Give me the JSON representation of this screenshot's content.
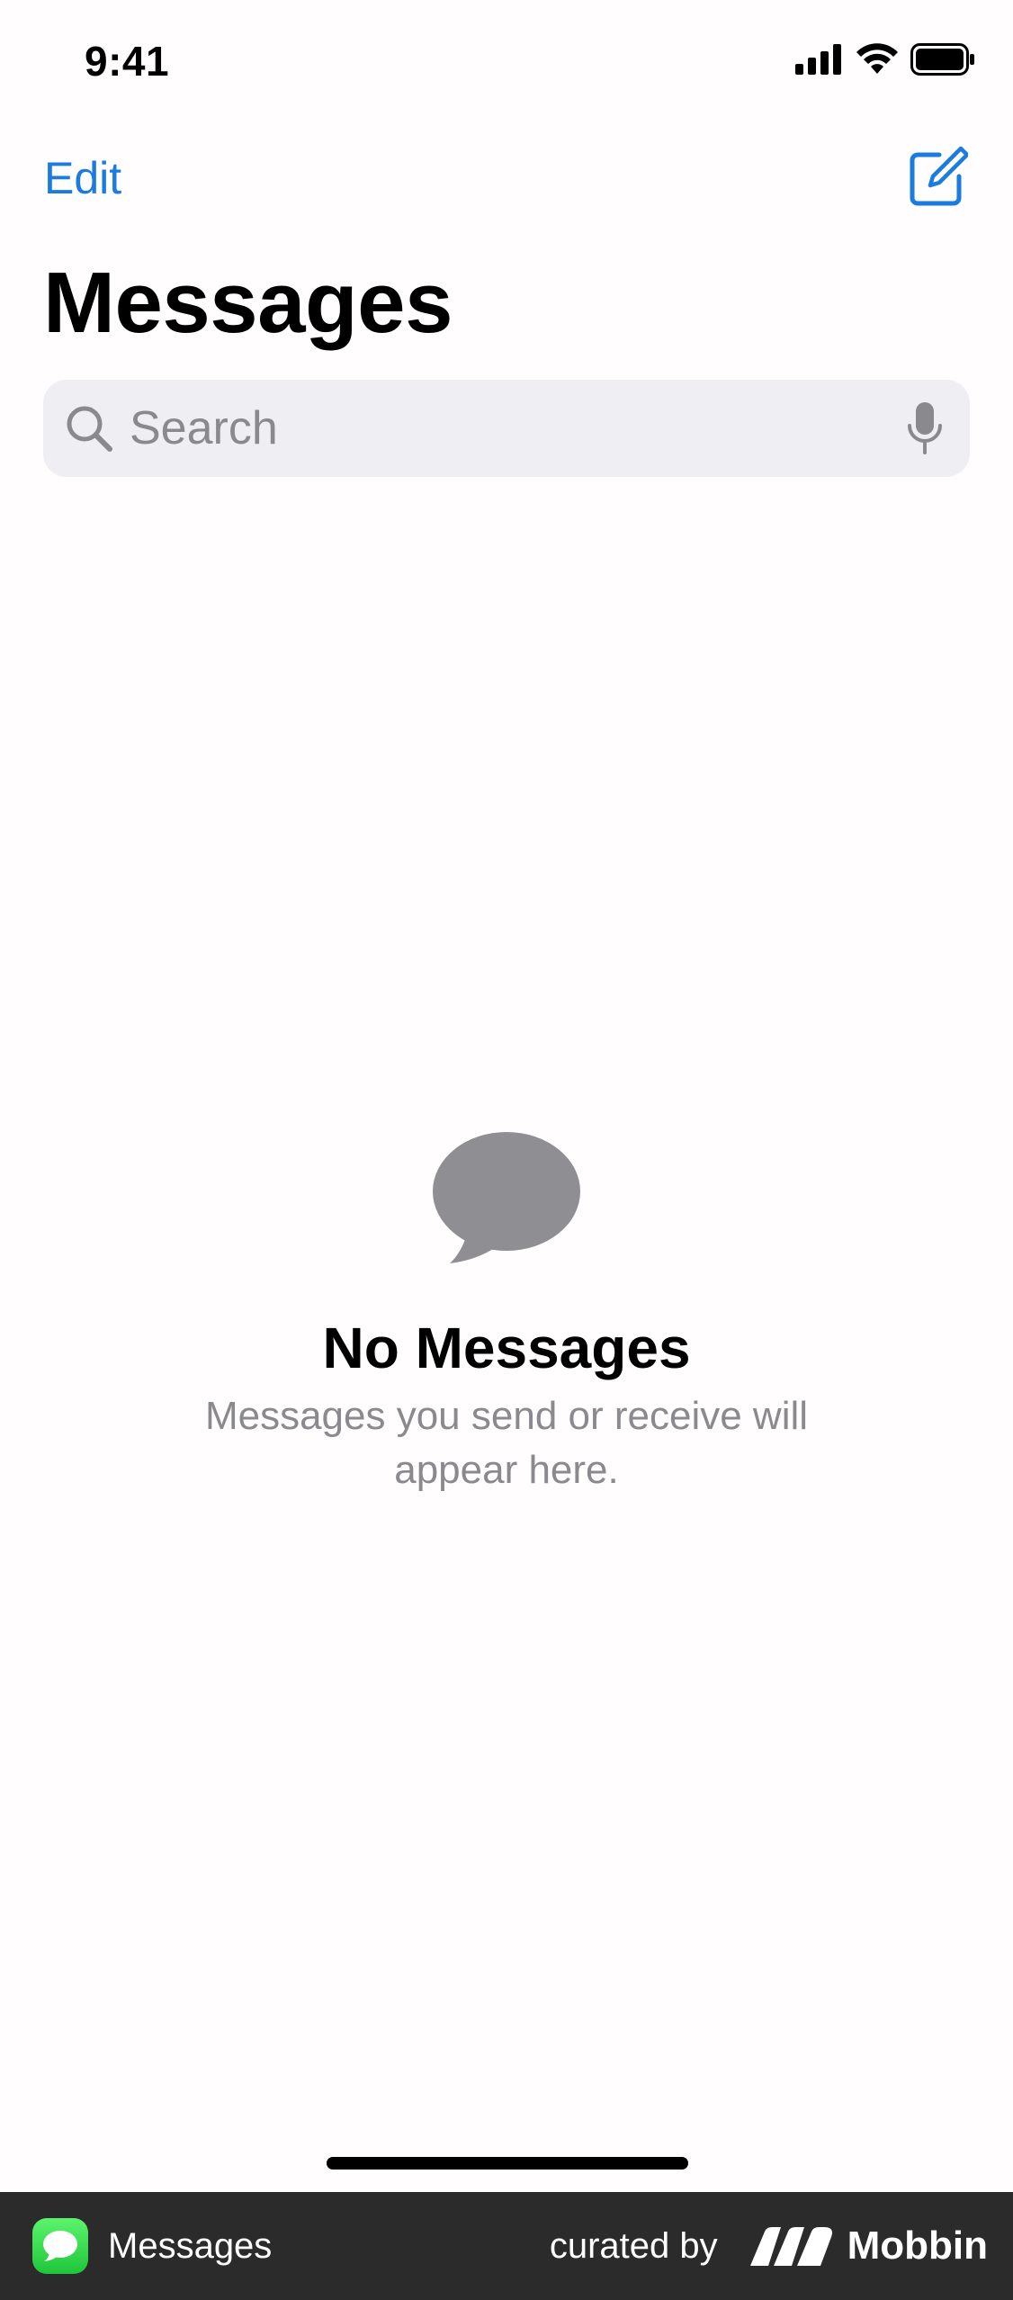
{
  "status_bar": {
    "time": "9:41"
  },
  "nav": {
    "edit_label": "Edit",
    "compose_icon": "compose-icon"
  },
  "page": {
    "title": "Messages"
  },
  "search": {
    "placeholder": "Search",
    "value": ""
  },
  "empty_state": {
    "icon": "speech-bubble-icon",
    "title": "No Messages",
    "subtitle": "Messages you send or receive will appear here."
  },
  "footer": {
    "app_name": "Messages",
    "curated_by": "curated by",
    "brand": "Mobbin"
  },
  "colors": {
    "accent": "#1a7be0",
    "background": "#fffdfe",
    "search_bg": "#efeef3",
    "secondary_text": "#8a8a8e",
    "empty_icon": "#8e8e93",
    "footer_bg": "#2b2b2c",
    "app_icon_green": "#34c759"
  }
}
